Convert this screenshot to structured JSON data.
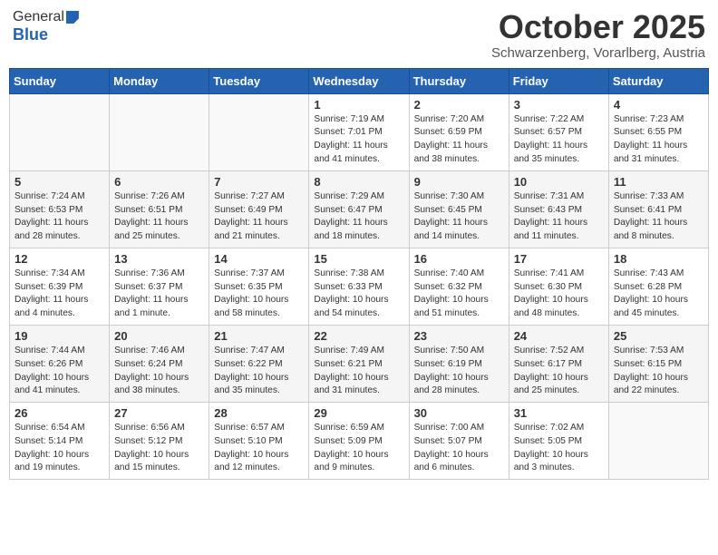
{
  "header": {
    "logo_general": "General",
    "logo_blue": "Blue",
    "month": "October 2025",
    "location": "Schwarzenberg, Vorarlberg, Austria"
  },
  "days_of_week": [
    "Sunday",
    "Monday",
    "Tuesday",
    "Wednesday",
    "Thursday",
    "Friday",
    "Saturday"
  ],
  "weeks": [
    [
      {
        "day": "",
        "sunrise": "",
        "sunset": "",
        "daylight": ""
      },
      {
        "day": "",
        "sunrise": "",
        "sunset": "",
        "daylight": ""
      },
      {
        "day": "",
        "sunrise": "",
        "sunset": "",
        "daylight": ""
      },
      {
        "day": "1",
        "sunrise": "Sunrise: 7:19 AM",
        "sunset": "Sunset: 7:01 PM",
        "daylight": "Daylight: 11 hours and 41 minutes."
      },
      {
        "day": "2",
        "sunrise": "Sunrise: 7:20 AM",
        "sunset": "Sunset: 6:59 PM",
        "daylight": "Daylight: 11 hours and 38 minutes."
      },
      {
        "day": "3",
        "sunrise": "Sunrise: 7:22 AM",
        "sunset": "Sunset: 6:57 PM",
        "daylight": "Daylight: 11 hours and 35 minutes."
      },
      {
        "day": "4",
        "sunrise": "Sunrise: 7:23 AM",
        "sunset": "Sunset: 6:55 PM",
        "daylight": "Daylight: 11 hours and 31 minutes."
      }
    ],
    [
      {
        "day": "5",
        "sunrise": "Sunrise: 7:24 AM",
        "sunset": "Sunset: 6:53 PM",
        "daylight": "Daylight: 11 hours and 28 minutes."
      },
      {
        "day": "6",
        "sunrise": "Sunrise: 7:26 AM",
        "sunset": "Sunset: 6:51 PM",
        "daylight": "Daylight: 11 hours and 25 minutes."
      },
      {
        "day": "7",
        "sunrise": "Sunrise: 7:27 AM",
        "sunset": "Sunset: 6:49 PM",
        "daylight": "Daylight: 11 hours and 21 minutes."
      },
      {
        "day": "8",
        "sunrise": "Sunrise: 7:29 AM",
        "sunset": "Sunset: 6:47 PM",
        "daylight": "Daylight: 11 hours and 18 minutes."
      },
      {
        "day": "9",
        "sunrise": "Sunrise: 7:30 AM",
        "sunset": "Sunset: 6:45 PM",
        "daylight": "Daylight: 11 hours and 14 minutes."
      },
      {
        "day": "10",
        "sunrise": "Sunrise: 7:31 AM",
        "sunset": "Sunset: 6:43 PM",
        "daylight": "Daylight: 11 hours and 11 minutes."
      },
      {
        "day": "11",
        "sunrise": "Sunrise: 7:33 AM",
        "sunset": "Sunset: 6:41 PM",
        "daylight": "Daylight: 11 hours and 8 minutes."
      }
    ],
    [
      {
        "day": "12",
        "sunrise": "Sunrise: 7:34 AM",
        "sunset": "Sunset: 6:39 PM",
        "daylight": "Daylight: 11 hours and 4 minutes."
      },
      {
        "day": "13",
        "sunrise": "Sunrise: 7:36 AM",
        "sunset": "Sunset: 6:37 PM",
        "daylight": "Daylight: 11 hours and 1 minute."
      },
      {
        "day": "14",
        "sunrise": "Sunrise: 7:37 AM",
        "sunset": "Sunset: 6:35 PM",
        "daylight": "Daylight: 10 hours and 58 minutes."
      },
      {
        "day": "15",
        "sunrise": "Sunrise: 7:38 AM",
        "sunset": "Sunset: 6:33 PM",
        "daylight": "Daylight: 10 hours and 54 minutes."
      },
      {
        "day": "16",
        "sunrise": "Sunrise: 7:40 AM",
        "sunset": "Sunset: 6:32 PM",
        "daylight": "Daylight: 10 hours and 51 minutes."
      },
      {
        "day": "17",
        "sunrise": "Sunrise: 7:41 AM",
        "sunset": "Sunset: 6:30 PM",
        "daylight": "Daylight: 10 hours and 48 minutes."
      },
      {
        "day": "18",
        "sunrise": "Sunrise: 7:43 AM",
        "sunset": "Sunset: 6:28 PM",
        "daylight": "Daylight: 10 hours and 45 minutes."
      }
    ],
    [
      {
        "day": "19",
        "sunrise": "Sunrise: 7:44 AM",
        "sunset": "Sunset: 6:26 PM",
        "daylight": "Daylight: 10 hours and 41 minutes."
      },
      {
        "day": "20",
        "sunrise": "Sunrise: 7:46 AM",
        "sunset": "Sunset: 6:24 PM",
        "daylight": "Daylight: 10 hours and 38 minutes."
      },
      {
        "day": "21",
        "sunrise": "Sunrise: 7:47 AM",
        "sunset": "Sunset: 6:22 PM",
        "daylight": "Daylight: 10 hours and 35 minutes."
      },
      {
        "day": "22",
        "sunrise": "Sunrise: 7:49 AM",
        "sunset": "Sunset: 6:21 PM",
        "daylight": "Daylight: 10 hours and 31 minutes."
      },
      {
        "day": "23",
        "sunrise": "Sunrise: 7:50 AM",
        "sunset": "Sunset: 6:19 PM",
        "daylight": "Daylight: 10 hours and 28 minutes."
      },
      {
        "day": "24",
        "sunrise": "Sunrise: 7:52 AM",
        "sunset": "Sunset: 6:17 PM",
        "daylight": "Daylight: 10 hours and 25 minutes."
      },
      {
        "day": "25",
        "sunrise": "Sunrise: 7:53 AM",
        "sunset": "Sunset: 6:15 PM",
        "daylight": "Daylight: 10 hours and 22 minutes."
      }
    ],
    [
      {
        "day": "26",
        "sunrise": "Sunrise: 6:54 AM",
        "sunset": "Sunset: 5:14 PM",
        "daylight": "Daylight: 10 hours and 19 minutes."
      },
      {
        "day": "27",
        "sunrise": "Sunrise: 6:56 AM",
        "sunset": "Sunset: 5:12 PM",
        "daylight": "Daylight: 10 hours and 15 minutes."
      },
      {
        "day": "28",
        "sunrise": "Sunrise: 6:57 AM",
        "sunset": "Sunset: 5:10 PM",
        "daylight": "Daylight: 10 hours and 12 minutes."
      },
      {
        "day": "29",
        "sunrise": "Sunrise: 6:59 AM",
        "sunset": "Sunset: 5:09 PM",
        "daylight": "Daylight: 10 hours and 9 minutes."
      },
      {
        "day": "30",
        "sunrise": "Sunrise: 7:00 AM",
        "sunset": "Sunset: 5:07 PM",
        "daylight": "Daylight: 10 hours and 6 minutes."
      },
      {
        "day": "31",
        "sunrise": "Sunrise: 7:02 AM",
        "sunset": "Sunset: 5:05 PM",
        "daylight": "Daylight: 10 hours and 3 minutes."
      },
      {
        "day": "",
        "sunrise": "",
        "sunset": "",
        "daylight": ""
      }
    ]
  ]
}
